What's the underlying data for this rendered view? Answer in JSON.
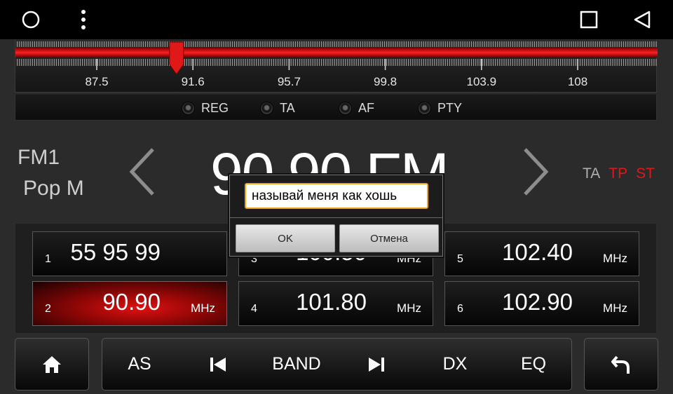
{
  "navbar": {
    "home_icon": "circle-home-icon",
    "menu_icon": "vertical-dots-icon",
    "recents_icon": "square-recents-icon",
    "back_icon": "triangle-back-icon"
  },
  "scale": {
    "ticks": [
      "87.5",
      "91.6",
      "95.7",
      "99.8",
      "103.9",
      "108"
    ],
    "range_mhz": [
      87.5,
      108
    ],
    "marker_mhz": 90.9,
    "marker_color": "#e01818"
  },
  "flags": [
    "REG",
    "TA",
    "AF",
    "PTY"
  ],
  "display": {
    "band": "FM1",
    "ps_name": "Pop M",
    "frequency": "90.90 FM",
    "indicators": [
      {
        "label": "TA",
        "color": "#b0b0b0"
      },
      {
        "label": "TP",
        "color": "#e01818"
      },
      {
        "label": "ST",
        "color": "#e01818"
      }
    ]
  },
  "presets": [
    {
      "num": "1",
      "freq": "55 95 99",
      "unit": ""
    },
    {
      "num": "3",
      "freq": "100.50",
      "unit": "MHz"
    },
    {
      "num": "5",
      "freq": "102.40",
      "unit": "MHz"
    },
    {
      "num": "2",
      "freq": "90.90",
      "unit": "MHz"
    },
    {
      "num": "4",
      "freq": "101.80",
      "unit": "MHz"
    },
    {
      "num": "6",
      "freq": "102.90",
      "unit": "MHz"
    }
  ],
  "toolbar": {
    "home_icon": "home-icon",
    "as": "AS",
    "prev_icon": "skip-previous-icon",
    "band": "BAND",
    "next_icon": "skip-next-icon",
    "dx": "DX",
    "eq": "EQ",
    "back_icon": "return-icon"
  },
  "dialog": {
    "input_value": "называй меня как хошь",
    "ok": "OK",
    "cancel": "Отмена",
    "accent": "#f0a020"
  }
}
